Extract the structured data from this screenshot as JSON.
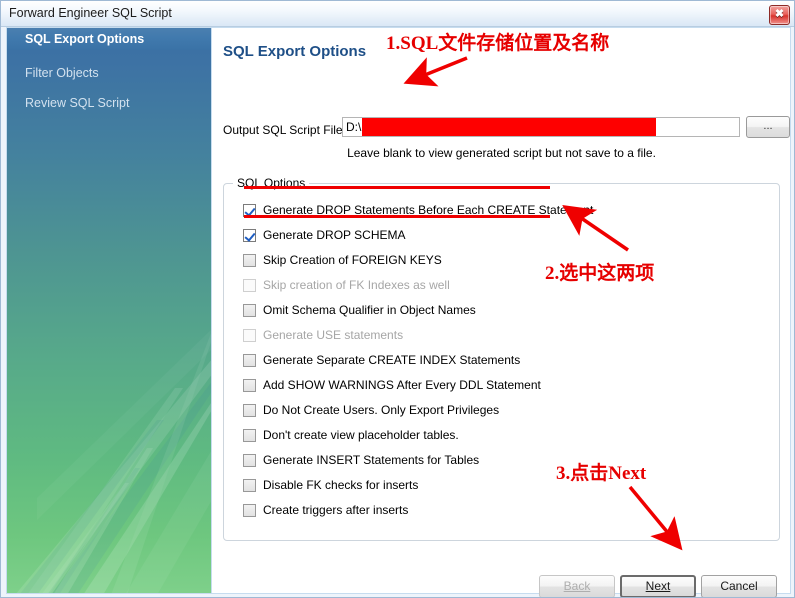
{
  "window": {
    "title": "Forward Engineer SQL Script",
    "close_icon": "close-icon",
    "close_glyph": "✖"
  },
  "sidebar": {
    "items": [
      {
        "label": "SQL Export Options",
        "active": true
      },
      {
        "label": "Filter Objects",
        "active": false
      },
      {
        "label": "Review SQL Script",
        "active": false
      }
    ]
  },
  "main": {
    "heading": "SQL Export Options",
    "output_file": {
      "label": "Output SQL Script File:",
      "value": "D:\\",
      "redacted": true,
      "browse_label": "..."
    },
    "hint": "Leave blank to view generated script but not save to a file.",
    "group": {
      "title": "SQL Options",
      "options": [
        {
          "label": "Generate DROP Statements Before Each CREATE Statement",
          "checked": true,
          "disabled": false
        },
        {
          "label": "Generate DROP SCHEMA",
          "checked": true,
          "disabled": false
        },
        {
          "label": "Skip Creation of FOREIGN KEYS",
          "checked": false,
          "disabled": false
        },
        {
          "label": "Skip creation of FK Indexes as well",
          "checked": false,
          "disabled": true
        },
        {
          "label": "Omit Schema Qualifier in Object Names",
          "checked": false,
          "disabled": false
        },
        {
          "label": "Generate USE statements",
          "checked": false,
          "disabled": true
        },
        {
          "label": "Generate Separate CREATE INDEX Statements",
          "checked": false,
          "disabled": false
        },
        {
          "label": "Add SHOW WARNINGS After Every DDL Statement",
          "checked": false,
          "disabled": false
        },
        {
          "label": "Do Not Create Users. Only Export Privileges",
          "checked": false,
          "disabled": false
        },
        {
          "label": "Don't create view placeholder tables.",
          "checked": false,
          "disabled": false
        },
        {
          "label": "Generate INSERT Statements for Tables",
          "checked": false,
          "disabled": false
        },
        {
          "label": "Disable FK checks for inserts",
          "checked": false,
          "disabled": false
        },
        {
          "label": "Create triggers after inserts",
          "checked": false,
          "disabled": false
        }
      ]
    }
  },
  "buttons": {
    "back": "Back",
    "next": "Next",
    "cancel": "Cancel"
  },
  "annotations": [
    {
      "id": "anno1",
      "text": "1.SQL文件存储位置及名称"
    },
    {
      "id": "anno2",
      "text": "2.选中这两项"
    },
    {
      "id": "anno3",
      "text": "3.点击Next"
    }
  ],
  "colors": {
    "annotation_red": "#e60000",
    "redaction_red": "#fe0000",
    "heading_blue": "#1e4f87",
    "sidebar_top": "#3b6fa3",
    "sidebar_bottom": "#7ed08a"
  }
}
